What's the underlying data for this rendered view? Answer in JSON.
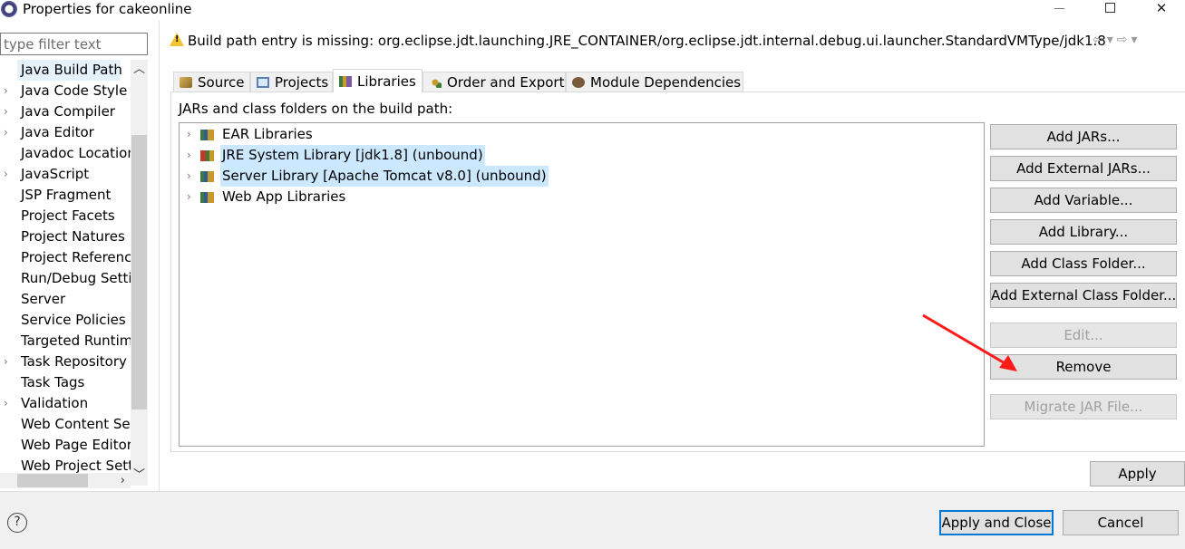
{
  "window": {
    "title": "Properties for cakeonline",
    "controls": [
      "minimize",
      "maximize",
      "close"
    ]
  },
  "left_panel": {
    "filter_placeholder": "type filter text",
    "items": [
      {
        "label": "Java Build Path",
        "expandable": false,
        "selected": true
      },
      {
        "label": "Java Code Style",
        "expandable": true
      },
      {
        "label": "Java Compiler",
        "expandable": true
      },
      {
        "label": "Java Editor",
        "expandable": true
      },
      {
        "label": "Javadoc Location",
        "expandable": false
      },
      {
        "label": "JavaScript",
        "expandable": true
      },
      {
        "label": "JSP Fragment",
        "expandable": false
      },
      {
        "label": "Project Facets",
        "expandable": false
      },
      {
        "label": "Project Natures",
        "expandable": false
      },
      {
        "label": "Project References",
        "expandable": false
      },
      {
        "label": "Run/Debug Settings",
        "expandable": false
      },
      {
        "label": "Server",
        "expandable": false
      },
      {
        "label": "Service Policies",
        "expandable": false
      },
      {
        "label": "Targeted Runtimes",
        "expandable": false
      },
      {
        "label": "Task Repository",
        "expandable": true
      },
      {
        "label": "Task Tags",
        "expandable": false
      },
      {
        "label": "Validation",
        "expandable": true
      },
      {
        "label": "Web Content Settings",
        "expandable": false
      },
      {
        "label": "Web Page Editor",
        "expandable": false
      },
      {
        "label": "Web Project Settings",
        "expandable": false
      }
    ]
  },
  "header": {
    "message": "Build path entry is missing: org.eclipse.jdt.launching.JRE_CONTAINER/org.eclipse.jdt.internal.debug.ui.launcher.StandardVMType/jdk1.8",
    "icon": "warning-icon"
  },
  "tabs": {
    "source": "Source",
    "projects": "Projects",
    "libraries": "Libraries",
    "order": "Order and Export",
    "module": "Module Dependencies",
    "active": "libraries"
  },
  "libraries": {
    "caption": "JARs and class folders on the build path:",
    "rows": [
      {
        "label": "EAR Libraries",
        "highlighted": false
      },
      {
        "label": "JRE System Library [jdk1.8] (unbound)",
        "highlighted": true
      },
      {
        "label": "Server Library [Apache Tomcat v8.0] (unbound)",
        "highlighted": true
      },
      {
        "label": "Web App Libraries",
        "highlighted": false
      }
    ]
  },
  "buttons": {
    "add_jars": "Add JARs...",
    "add_external_jars": "Add External JARs...",
    "add_variable": "Add Variable...",
    "add_library": "Add Library...",
    "add_class_folder": "Add Class Folder...",
    "add_external_class_folder": "Add External Class Folder...",
    "edit": "Edit...",
    "remove": "Remove",
    "migrate_jar": "Migrate JAR File...",
    "apply": "Apply",
    "apply_and_close": "Apply and Close",
    "cancel": "Cancel"
  },
  "footer": {
    "help_glyph": "?"
  },
  "colors": {
    "selection": "#cce8ff",
    "focus_border": "#0078d7",
    "annotation_arrow": "#ff0000",
    "warning": "#f4c430"
  }
}
